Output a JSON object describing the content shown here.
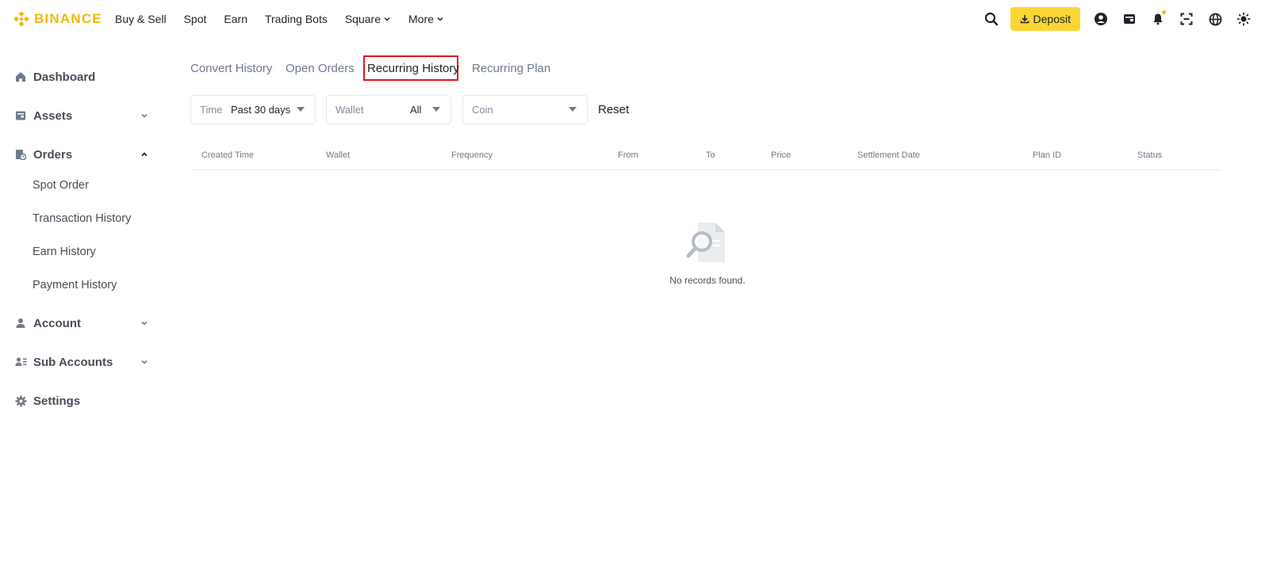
{
  "brand": {
    "name": "BINANCE",
    "color": "#F0B90B"
  },
  "nav": {
    "items": [
      {
        "label": "Buy & Sell",
        "dropdown": false
      },
      {
        "label": "Spot",
        "dropdown": false
      },
      {
        "label": "Earn",
        "dropdown": false
      },
      {
        "label": "Trading Bots",
        "dropdown": false
      },
      {
        "label": "Square",
        "dropdown": true
      },
      {
        "label": "More",
        "dropdown": true
      }
    ],
    "deposit_label": "Deposit",
    "icons": [
      "search-icon",
      "download-icon",
      "user-icon",
      "wallet-icon",
      "bell-icon",
      "scan-icon",
      "globe-icon",
      "theme-icon"
    ]
  },
  "sidebar": {
    "items": [
      {
        "label": "Dashboard",
        "icon": "home-icon"
      },
      {
        "label": "Assets",
        "icon": "wallet-icon",
        "expandable": true,
        "expanded": false
      },
      {
        "label": "Orders",
        "icon": "orders-icon",
        "expandable": true,
        "expanded": true,
        "children": [
          "Spot Order",
          "Transaction History",
          "Earn History",
          "Payment History"
        ]
      },
      {
        "label": "Account",
        "icon": "user-icon",
        "expandable": true,
        "expanded": false
      },
      {
        "label": "Sub Accounts",
        "icon": "sub-accounts-icon",
        "expandable": true,
        "expanded": false
      },
      {
        "label": "Settings",
        "icon": "gear-icon"
      }
    ]
  },
  "tabs": [
    {
      "label": "Convert History",
      "active": false
    },
    {
      "label": "Open Orders",
      "active": false
    },
    {
      "label": "Recurring History",
      "active": true
    },
    {
      "label": "Recurring Plan",
      "active": false
    }
  ],
  "filters": {
    "time": {
      "label": "Time",
      "value": "Past 30 days"
    },
    "wallet": {
      "label": "Wallet",
      "value": "All"
    },
    "coin": {
      "placeholder": "Coin"
    },
    "reset_label": "Reset"
  },
  "table": {
    "columns": [
      "Created Time",
      "Wallet",
      "Frequency",
      "From",
      "To",
      "Price",
      "Settlement Date",
      "Plan ID",
      "Status"
    ],
    "rows": [],
    "empty_text": "No records found."
  },
  "colors": {
    "accent": "#FCD535",
    "active_tab_outline": "#e3131a",
    "text_primary": "#1e2329",
    "text_secondary": "#707a8a"
  }
}
